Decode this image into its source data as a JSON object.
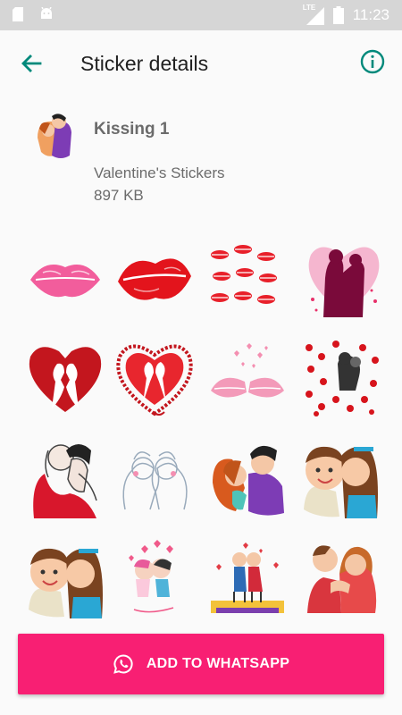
{
  "status_bar": {
    "time": "11:23",
    "network": "LTE",
    "icons": [
      "sd-card-icon",
      "android-icon",
      "signal-icon",
      "battery-icon"
    ]
  },
  "toolbar": {
    "title": "Sticker details",
    "back_icon": "arrow-back-icon",
    "info_icon": "info-icon",
    "accent_color": "#00897b"
  },
  "pack": {
    "name": "Kissing 1",
    "publisher": "Valentine's Stickers",
    "size": "897 KB"
  },
  "stickers": [
    {
      "name": "sticker-pink-lips"
    },
    {
      "name": "sticker-red-lips"
    },
    {
      "name": "sticker-many-lips"
    },
    {
      "name": "sticker-heart-silhouette-couple"
    },
    {
      "name": "sticker-broken-heart-kiss"
    },
    {
      "name": "sticker-lace-heart-kiss"
    },
    {
      "name": "sticker-lips-with-hearts"
    },
    {
      "name": "sticker-couple-with-red-hearts"
    },
    {
      "name": "sticker-sketch-kiss"
    },
    {
      "name": "sticker-line-art-kiss"
    },
    {
      "name": "sticker-cartoon-couple-kiss"
    },
    {
      "name": "sticker-cartoon-cheek-kiss"
    },
    {
      "name": "sticker-cartoon-cheek-kiss-2"
    },
    {
      "name": "sticker-cute-couple-balloons"
    },
    {
      "name": "sticker-couple-bench"
    },
    {
      "name": "sticker-couple-red-dress"
    }
  ],
  "add_button": {
    "label": "ADD TO WHATSAPP",
    "icon": "whatsapp-icon",
    "color": "#f81f73"
  }
}
